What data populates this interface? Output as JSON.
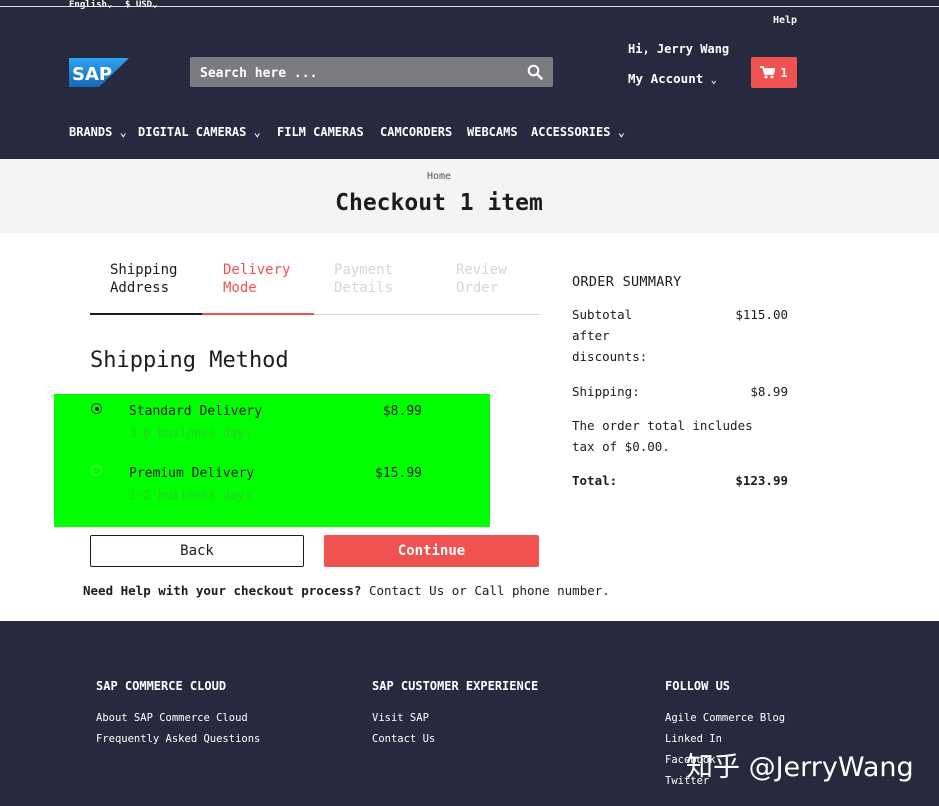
{
  "topbar": {
    "language": "English",
    "currency": "$ USD",
    "help": "Help"
  },
  "brand": {
    "logo_text": "SAP",
    "logo_color": "#1f73b7"
  },
  "search": {
    "placeholder": "Search here ..."
  },
  "account": {
    "greeting": "Hi, Jerry Wang",
    "my_account": "My Account"
  },
  "cart": {
    "count": "1"
  },
  "nav": [
    {
      "label": "BRANDS",
      "has_menu": true
    },
    {
      "label": "DIGITAL CAMERAS",
      "has_menu": true
    },
    {
      "label": "FILM CAMERAS",
      "has_menu": false
    },
    {
      "label": "CAMCORDERS",
      "has_menu": false
    },
    {
      "label": "WEBCAMS",
      "has_menu": false
    },
    {
      "label": "ACCESSORIES",
      "has_menu": true
    }
  ],
  "breadcrumb": "Home",
  "page_title": "Checkout 1 item",
  "steps": [
    {
      "line1": "Shipping",
      "line2": "Address",
      "state": "done"
    },
    {
      "line1": "Delivery",
      "line2": "Mode",
      "state": "active"
    },
    {
      "line1": "Payment",
      "line2": "Details",
      "state": "disabled"
    },
    {
      "line1": "Review",
      "line2": "Order",
      "state": "disabled"
    }
  ],
  "shipping": {
    "title": "Shipping Method",
    "options": [
      {
        "name": "Standard Delivery",
        "desc": "3-6 business days",
        "price": "$8.99",
        "selected": true
      },
      {
        "name": "Premium Delivery",
        "desc": "1-2 business days",
        "price": "$15.99",
        "selected": false
      }
    ]
  },
  "buttons": {
    "back": "Back",
    "continue": "Continue"
  },
  "help": {
    "bold": "Need Help with your checkout process?",
    "rest": " Contact Us or Call phone number."
  },
  "summary": {
    "title": "ORDER SUMMARY",
    "subtotal_l1": "Subtotal",
    "subtotal_l2": "after",
    "subtotal_l3": "discounts:",
    "subtotal": "$115.00",
    "shipping_label": "Shipping:",
    "shipping": "$8.99",
    "tax_l1": "The order total includes",
    "tax_l2": "tax of $0.00.",
    "total_label": "Total:",
    "total": "$123.99"
  },
  "footer": {
    "col1": {
      "title": "SAP COMMERCE CLOUD",
      "links": [
        "About SAP Commerce Cloud",
        "Frequently Asked Questions"
      ]
    },
    "col2": {
      "title": "SAP CUSTOMER EXPERIENCE",
      "links": [
        "Visit SAP",
        "Contact Us"
      ]
    },
    "col3": {
      "title": "FOLLOW US",
      "links": [
        "Agile Commerce Blog",
        "Linked In",
        "Facebook",
        "Twitter"
      ]
    }
  },
  "watermark": "知乎 @JerryWang",
  "colors": {
    "header_bg": "#272a3e",
    "accent": "#f05252",
    "highlight": "#00ff00"
  }
}
